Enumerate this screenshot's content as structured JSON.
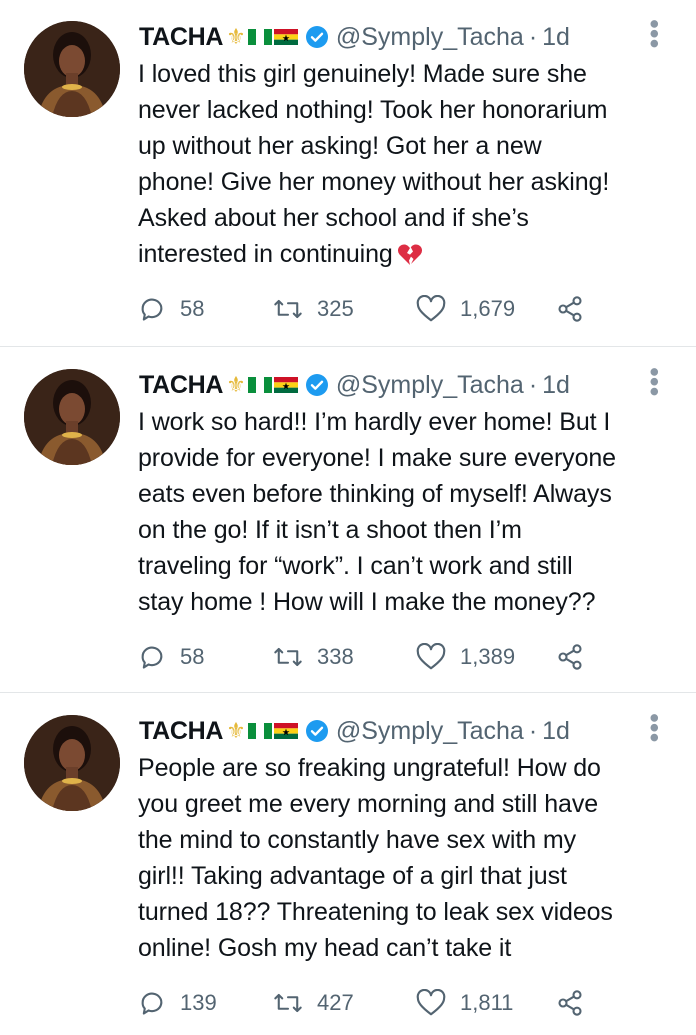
{
  "tweets": [
    {
      "author": {
        "name": "TACHA",
        "handle": "@Symply_Tacha",
        "verified": true
      },
      "time": "1d",
      "text": [
        "I loved this girl genuinely! Made sure she",
        "never lacked nothing! Took her honorarium",
        "up without her asking! Got her a new",
        "phone! Give her money without her asking!",
        "Asked about her school and if she’s",
        "interested in continuing"
      ],
      "emoji": "broken-heart-icon",
      "replies": "58",
      "retweets": "325",
      "likes": "1,679"
    },
    {
      "author": {
        "name": "TACHA",
        "handle": "@Symply_Tacha",
        "verified": true
      },
      "time": "1d",
      "text": [
        "I work so hard!! I’m hardly ever home! But I",
        "provide for everyone! I make sure everyone",
        "eats even before thinking of myself! Always",
        "on the go! If it isn’t a shoot then I’m",
        "traveling for “work”. I can’t work and still",
        "stay home ! How will I make the money??"
      ],
      "replies": "58",
      "retweets": "338",
      "likes": "1,389"
    },
    {
      "author": {
        "name": "TACHA",
        "handle": "@Symply_Tacha",
        "verified": true
      },
      "time": "1d",
      "text": [
        "People are so freaking ungrateful! How do",
        "you greet me every morning and still have",
        "the mind to constantly have sex with my",
        "girl!! Taking advantage of a girl that just",
        "turned 18?? Threatening to leak sex videos",
        "online! Gosh my head can’t take it"
      ],
      "replies": "139",
      "retweets": "427",
      "likes": "1,811"
    }
  ],
  "colors": {
    "verified": "#1d9bf0",
    "secondary_text": "#536471",
    "divider": "#e3e6e8"
  }
}
